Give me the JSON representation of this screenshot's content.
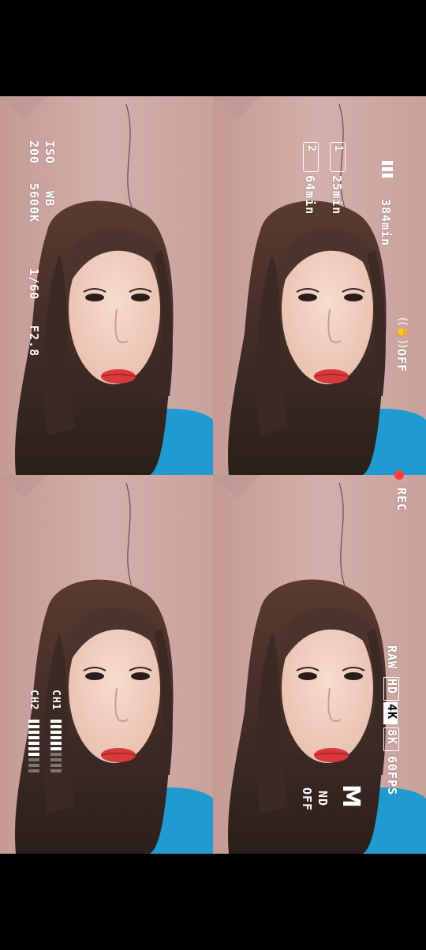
{
  "osd": {
    "iso_label": "ISO",
    "iso_value": "200",
    "wb_label": "WB",
    "wb_value": "5600K",
    "shutter": "1/60",
    "aperture": "F2.8",
    "battery_time": "384min",
    "card1_id": "1",
    "card1_time": "25min",
    "card2_id": "2",
    "card2_time": "64min",
    "stabilizer": "OFF",
    "rec_label": "REC",
    "format_raw": "RAW",
    "format_hd": "HD",
    "format_4k": "4K",
    "format_8k": "8K",
    "format_fps": "60FPS",
    "nd_label": "ND",
    "nd_value": "OFF",
    "mode_mark": "M",
    "ch1_label": "CH1",
    "ch2_label": "CH2"
  },
  "meters": {
    "ch1_level": 0.55,
    "ch2_level": 0.65
  },
  "colors": {
    "wall": "#c9a5a0",
    "hair": "#3a2a25",
    "skin": "#f2d2c4",
    "lips": "#d63a3a",
    "shirt": "#1f9bd1",
    "rec": "#ff3b3b",
    "osd_text": "#ffffff"
  }
}
